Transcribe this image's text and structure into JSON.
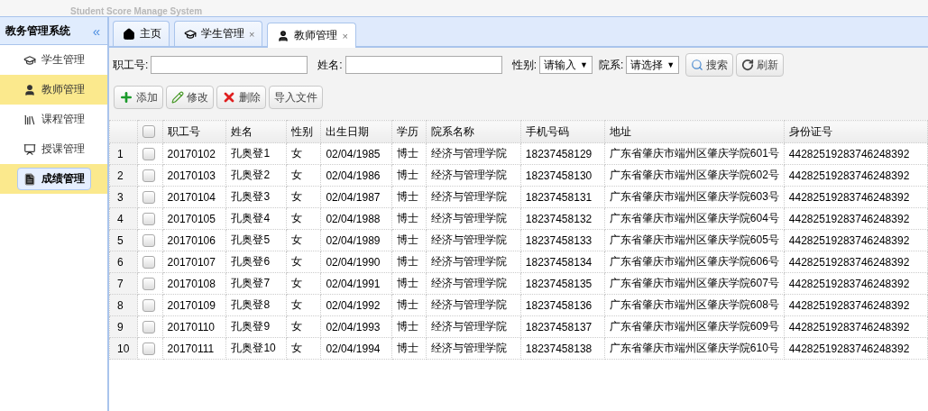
{
  "header": {
    "title": "Student Score Manage System"
  },
  "sidebar": {
    "title": "教务管理系统",
    "collapse": "«",
    "items": [
      {
        "label": "学生管理",
        "selected": false,
        "focused": false
      },
      {
        "label": "教师管理",
        "selected": true,
        "focused": false
      },
      {
        "label": "课程管理",
        "selected": false,
        "focused": false
      },
      {
        "label": "授课管理",
        "selected": false,
        "focused": false
      },
      {
        "label": "成绩管理",
        "selected": true,
        "focused": true
      }
    ]
  },
  "tabs": [
    {
      "label": "主页",
      "closable": false,
      "selected": false
    },
    {
      "label": "学生管理",
      "closable": true,
      "selected": false
    },
    {
      "label": "教师管理",
      "closable": true,
      "selected": true
    }
  ],
  "tab_close": "×",
  "filters": [
    {
      "kind": "text",
      "label": "职工号:"
    },
    {
      "kind": "text",
      "label": "姓名:"
    },
    {
      "kind": "select",
      "label": "性别:",
      "value": "请输入",
      "caret": "▼"
    },
    {
      "kind": "select",
      "label": "院系:",
      "value": "请选择",
      "caret": "▼"
    }
  ],
  "search_buttons": [
    "搜索",
    "刷新"
  ],
  "actions": [
    "添加",
    "修改",
    "删除",
    "导入文件"
  ],
  "table": {
    "columns": [
      "职工号",
      "姓名",
      "性别",
      "出生日期",
      "学历",
      "院系名称",
      "手机号码",
      "地址",
      "身份证号"
    ],
    "all_checked": false,
    "rows": [
      {
        "num": "1",
        "checked": false,
        "cells": [
          "20170102",
          "孔奥登1",
          "女",
          "02/04/1985",
          "博士",
          "经济与管理学院",
          "18237458129",
          "广东省肇庆市端州区肇庆学院601号",
          "44282519283746248392"
        ]
      },
      {
        "num": "2",
        "checked": false,
        "cells": [
          "20170103",
          "孔奥登2",
          "女",
          "02/04/1986",
          "博士",
          "经济与管理学院",
          "18237458130",
          "广东省肇庆市端州区肇庆学院602号",
          "44282519283746248392"
        ]
      },
      {
        "num": "3",
        "checked": false,
        "cells": [
          "20170104",
          "孔奥登3",
          "女",
          "02/04/1987",
          "博士",
          "经济与管理学院",
          "18237458131",
          "广东省肇庆市端州区肇庆学院603号",
          "44282519283746248392"
        ]
      },
      {
        "num": "4",
        "checked": false,
        "cells": [
          "20170105",
          "孔奥登4",
          "女",
          "02/04/1988",
          "博士",
          "经济与管理学院",
          "18237458132",
          "广东省肇庆市端州区肇庆学院604号",
          "44282519283746248392"
        ]
      },
      {
        "num": "5",
        "checked": false,
        "cells": [
          "20170106",
          "孔奥登5",
          "女",
          "02/04/1989",
          "博士",
          "经济与管理学院",
          "18237458133",
          "广东省肇庆市端州区肇庆学院605号",
          "44282519283746248392"
        ]
      },
      {
        "num": "6",
        "checked": false,
        "cells": [
          "20170107",
          "孔奥登6",
          "女",
          "02/04/1990",
          "博士",
          "经济与管理学院",
          "18237458134",
          "广东省肇庆市端州区肇庆学院606号",
          "44282519283746248392"
        ]
      },
      {
        "num": "7",
        "checked": false,
        "cells": [
          "20170108",
          "孔奥登7",
          "女",
          "02/04/1991",
          "博士",
          "经济与管理学院",
          "18237458135",
          "广东省肇庆市端州区肇庆学院607号",
          "44282519283746248392"
        ]
      },
      {
        "num": "8",
        "checked": false,
        "cells": [
          "20170109",
          "孔奥登8",
          "女",
          "02/04/1992",
          "博士",
          "经济与管理学院",
          "18237458136",
          "广东省肇庆市端州区肇庆学院608号",
          "44282519283746248392"
        ]
      },
      {
        "num": "9",
        "checked": false,
        "cells": [
          "20170110",
          "孔奥登9",
          "女",
          "02/04/1993",
          "博士",
          "经济与管理学院",
          "18237458137",
          "广东省肇庆市端州区肇庆学院609号",
          "44282519283746248392"
        ]
      },
      {
        "num": "10",
        "checked": false,
        "cells": [
          "20170111",
          "孔奥登10",
          "女",
          "02/04/1994",
          "博士",
          "经济与管理学院",
          "18237458138",
          "广东省肇庆市端州区肇庆学院610号",
          "44282519283746248392"
        ]
      }
    ]
  }
}
